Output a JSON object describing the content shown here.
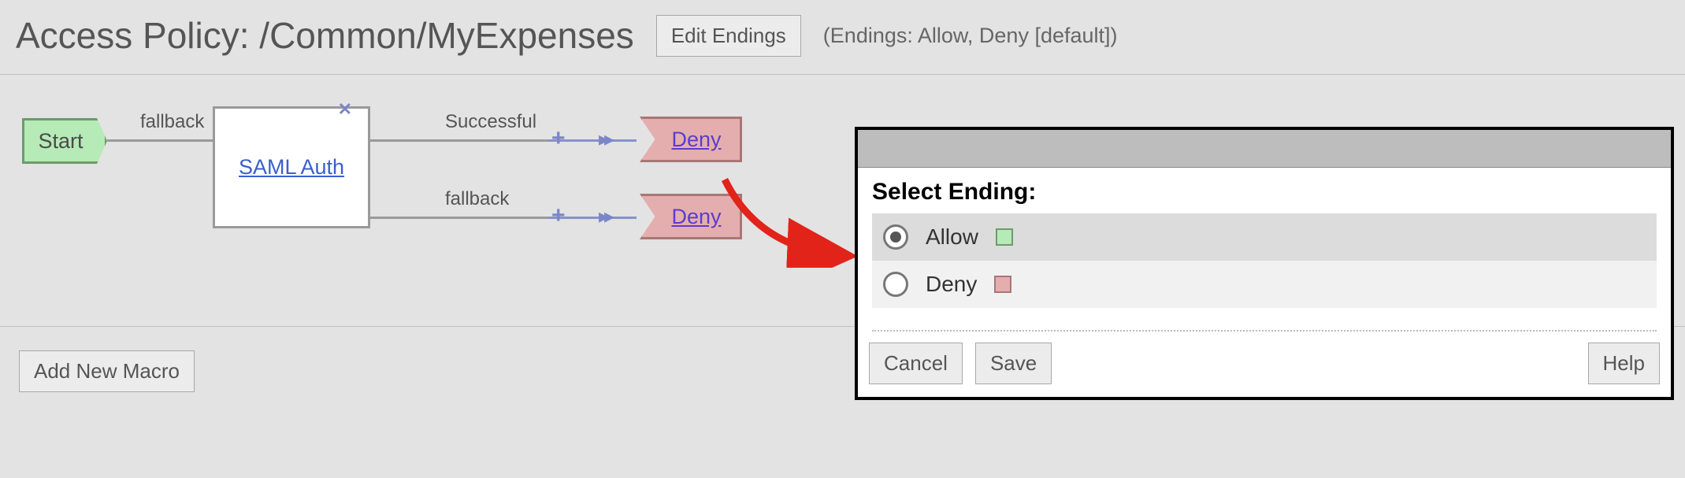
{
  "header": {
    "title": "Access Policy: /Common/MyExpenses",
    "edit_endings_label": "Edit Endings",
    "endings_summary": "(Endings: Allow, Deny [default])"
  },
  "flow": {
    "start_label": "Start",
    "saml_label": "SAML Auth",
    "branch1_label": "fallback",
    "branch_success_label": "Successful",
    "branch_fallback_label": "fallback",
    "deny1_label": "Deny",
    "deny2_label": "Deny"
  },
  "footer": {
    "add_macro_label": "Add New Macro"
  },
  "dialog": {
    "heading": "Select Ending:",
    "options": [
      {
        "label": "Allow",
        "color": "allow",
        "selected": true
      },
      {
        "label": "Deny",
        "color": "deny",
        "selected": false
      }
    ],
    "cancel_label": "Cancel",
    "save_label": "Save",
    "help_label": "Help"
  }
}
